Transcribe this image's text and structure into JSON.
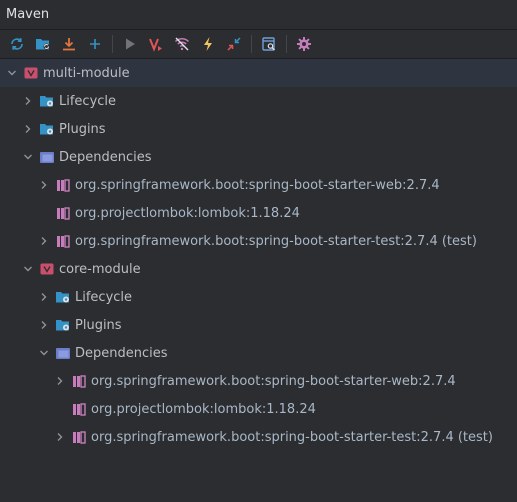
{
  "panel": {
    "title": "Maven"
  },
  "toolbar": {
    "buttons": [
      {
        "name": "reload-icon"
      },
      {
        "name": "generate-sources-icon"
      },
      {
        "name": "download-icon"
      },
      {
        "name": "add-icon"
      },
      {
        "name": "run-icon"
      },
      {
        "name": "execute-goal-icon"
      },
      {
        "name": "toggle-offline-icon"
      },
      {
        "name": "skip-tests-icon"
      },
      {
        "name": "collapse-all-icon"
      },
      {
        "name": "analyze-dependencies-icon"
      },
      {
        "name": "settings-icon"
      }
    ]
  },
  "tree": {
    "multi_module": {
      "label": "multi-module",
      "lifecycle": "Lifecycle",
      "plugins": "Plugins",
      "dependencies": "Dependencies",
      "deps": [
        "org.springframework.boot:spring-boot-starter-web:2.7.4",
        "org.projectlombok:lombok:1.18.24",
        "org.springframework.boot:spring-boot-starter-test:2.7.4 (test)"
      ]
    },
    "core_module": {
      "label": "core-module",
      "lifecycle": "Lifecycle",
      "plugins": "Plugins",
      "dependencies": "Dependencies",
      "deps": [
        "org.springframework.boot:spring-boot-starter-web:2.7.4",
        "org.projectlombok:lombok:1.18.24",
        "org.springframework.boot:spring-boot-starter-test:2.7.4 (test)"
      ]
    }
  },
  "colors": {
    "background": "#2b2d30",
    "selection": "#2e3540",
    "maven_module": "#c94f6d",
    "folder_blue": "#3592c4",
    "library_purple": "#c77dbb",
    "dependencies_folder": "#6b7fc9"
  }
}
